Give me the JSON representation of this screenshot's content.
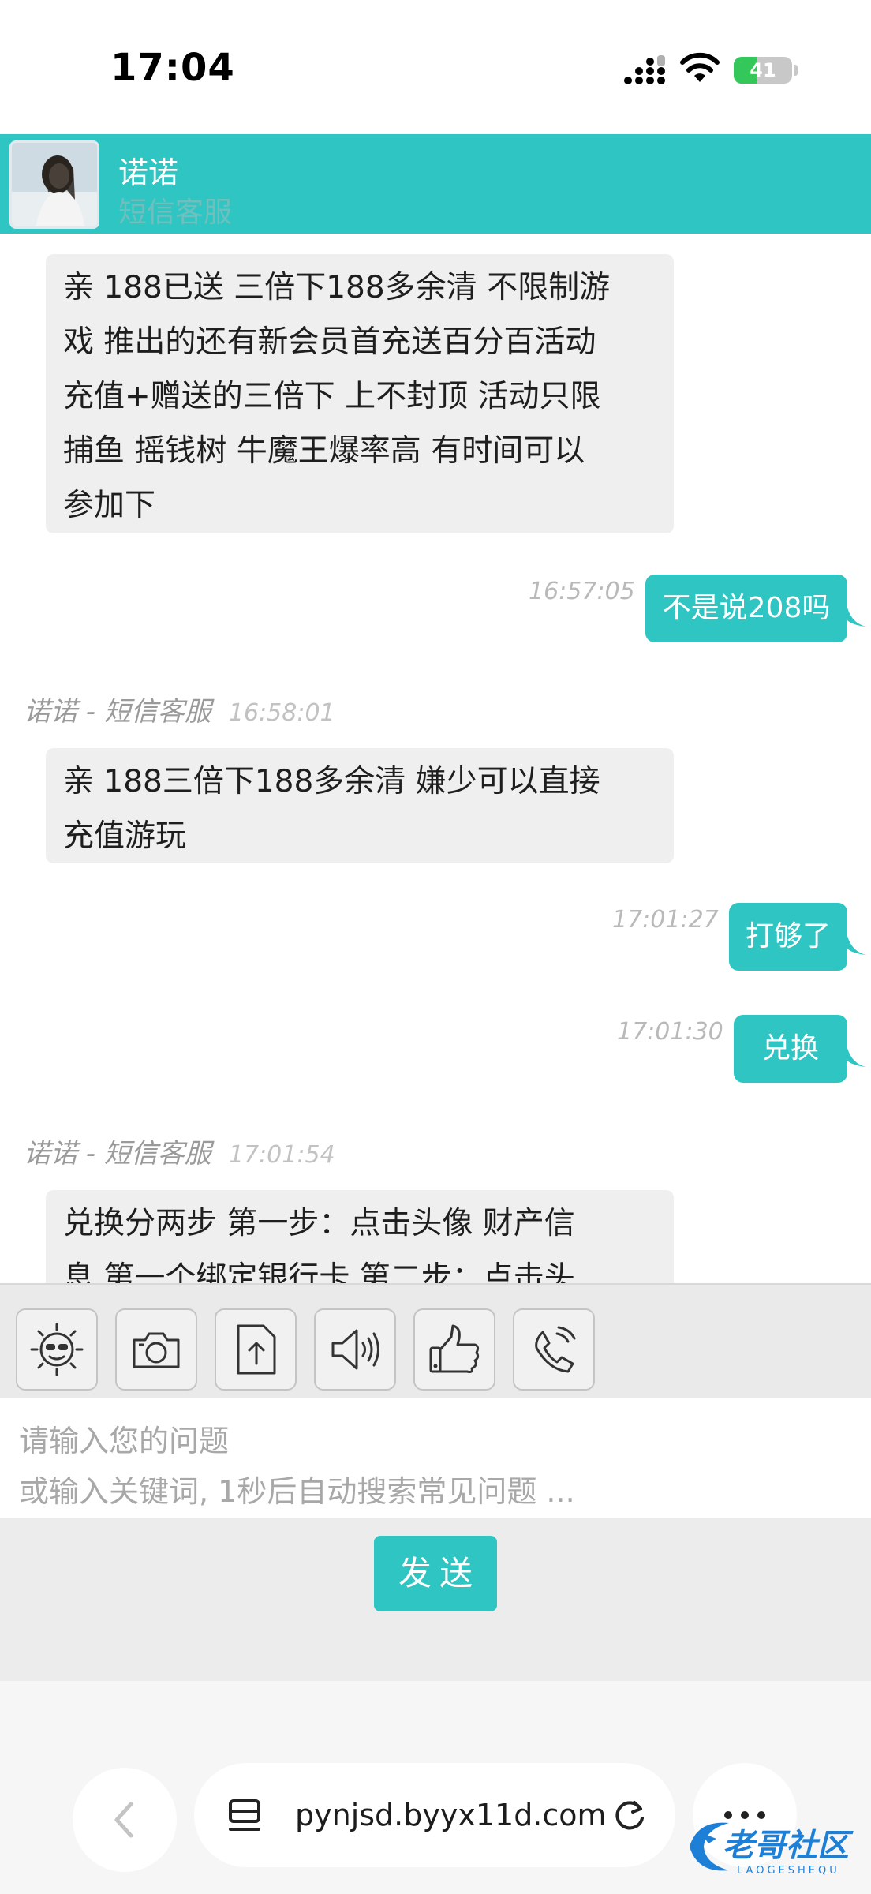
{
  "status": {
    "time": "17:04",
    "battery": "41",
    "battery_level": 0.41
  },
  "header": {
    "name": "诺诺",
    "role": "短信客服"
  },
  "messages": [
    {
      "dir": "in",
      "lines": [
        "亲 188已送 三倍下188多余清 不限制游",
        "戏 推出的还有新会员首充送百分百活动",
        "充值+赠送的三倍下 上不封顶 活动只限",
        "捕鱼 摇钱树 牛魔王爆率高 有时间可以",
        "参加下"
      ]
    },
    {
      "dir": "out",
      "time": "16:57:05",
      "text": "不是说208吗"
    },
    {
      "dir": "in",
      "sender": "诺诺 - 短信客服",
      "time": "16:58:01",
      "lines": [
        "亲 188三倍下188多余清 嫌少可以直接",
        "充值游玩"
      ]
    },
    {
      "dir": "out",
      "time": "17:01:27",
      "text": "打够了"
    },
    {
      "dir": "out",
      "time": "17:01:30",
      "text": "兑换"
    },
    {
      "dir": "in",
      "sender": "诺诺 - 短信客服",
      "time": "17:01:54",
      "lines": [
        "兑换分两步 第一步：点击头像 财产信",
        "息 第一个绑定银行卡 第二步：点击头"
      ]
    }
  ],
  "toolbar": [
    {
      "icon": "emoji-sunglasses-icon"
    },
    {
      "icon": "camera-icon"
    },
    {
      "icon": "file-upload-icon"
    },
    {
      "icon": "speaker-icon"
    },
    {
      "icon": "thumbs-up-icon"
    },
    {
      "icon": "phone-icon"
    }
  ],
  "input": {
    "placeholder": "请输入您的问题\n或输入关键词, 1秒后自动搜索常见问题 ..."
  },
  "send": {
    "label": "发送"
  },
  "browser": {
    "url": "pynjsd.byyx11d.com"
  },
  "watermark": {
    "text": "老哥社区",
    "sub": "LAOGESHEQU"
  },
  "colors": {
    "accent": "#2ec5c2",
    "incoming_bubble": "#efefef",
    "timestamp": "#b9b9b9"
  }
}
